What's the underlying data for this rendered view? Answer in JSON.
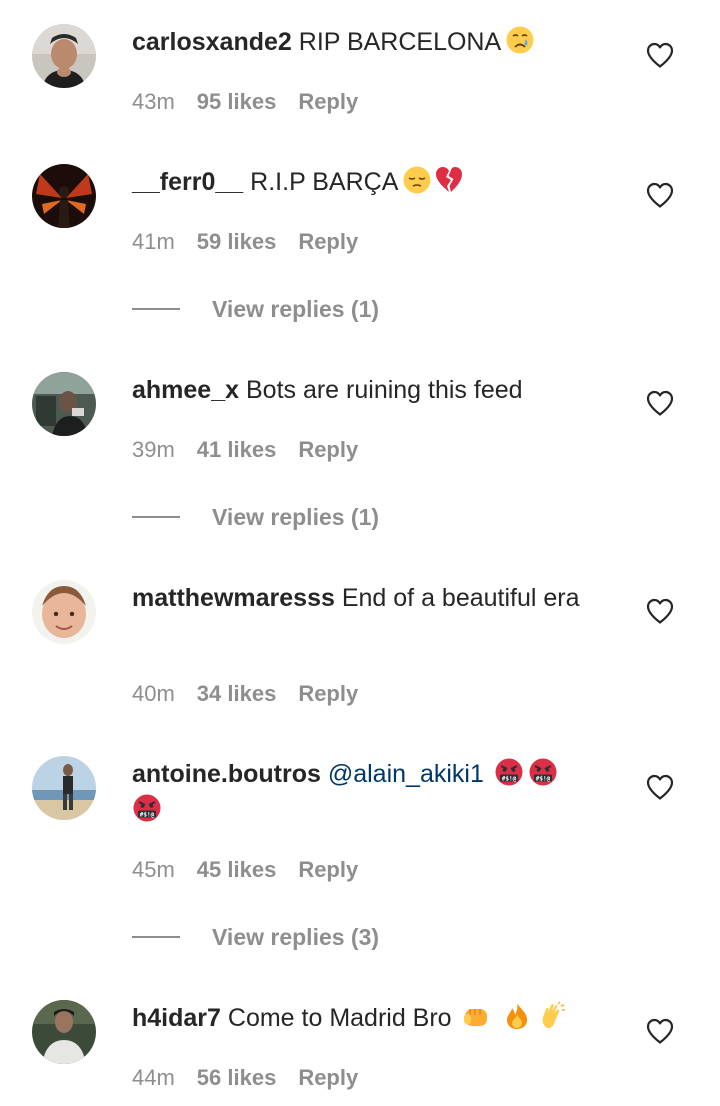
{
  "comments": [
    {
      "username": "carlosxande2",
      "text": "RIP BARCELONA",
      "emojis": [
        "crying-face"
      ],
      "time": "43m",
      "likes": "95 likes",
      "reply": "Reply"
    },
    {
      "username": "__ferr0__",
      "text": "R.I.P BARÇA",
      "emojis": [
        "pensive-face",
        "broken-heart"
      ],
      "time": "41m",
      "likes": "59 likes",
      "reply": "Reply",
      "view_replies": "View replies (1)"
    },
    {
      "username": "ahmee_x",
      "text": "Bots are ruining this feed",
      "time": "39m",
      "likes": "41 likes",
      "reply": "Reply",
      "view_replies": "View replies (1)"
    },
    {
      "username": "matthewmaresss",
      "text": "End of a beautiful era",
      "time": "40m",
      "likes": "34 likes",
      "reply": "Reply"
    },
    {
      "username": "antoine.boutros",
      "mention": "@alain_akiki1",
      "emojis": [
        "face-with-symbols-on-mouth",
        "face-with-symbols-on-mouth",
        "face-with-symbols-on-mouth"
      ],
      "time": "45m",
      "likes": "45 likes",
      "reply": "Reply",
      "view_replies": "View replies (3)"
    },
    {
      "username": "h4idar7",
      "text": "Come to Madrid Bro",
      "emojis": [
        "oncoming-fist",
        "fire",
        "clapping-hands"
      ],
      "time": "44m",
      "likes": "56 likes",
      "reply": "Reply"
    }
  ],
  "colors": {
    "text": "#262626",
    "secondary": "#8e8e8e",
    "mention": "#00376b",
    "background": "#ffffff"
  }
}
